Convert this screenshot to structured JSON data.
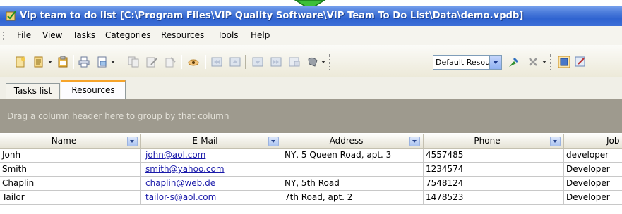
{
  "window": {
    "title": "Vip team to do list [C:\\Program Files\\VIP Quality Software\\VIP Team To Do List\\Data\\demo.vpdb]"
  },
  "menu": [
    "File",
    "View",
    "Tasks",
    "Categories",
    "Resources",
    "Tools",
    "Help"
  ],
  "toolbar": {
    "resource_combo_value": "Default Resou",
    "icons": [
      "new-task-icon",
      "new-item-icon",
      "clipboard-icon",
      "print-icon",
      "print-preview-icon",
      "copy-icon",
      "edit-icon",
      "delete-icon",
      "find-icon",
      "first-icon",
      "previous-icon",
      "next-icon",
      "last-icon",
      "filter-icon",
      "add-resource-icon",
      "remove-resource-icon",
      "view-icon",
      "settings-icon"
    ]
  },
  "tabs": [
    "Tasks list",
    "Resources"
  ],
  "active_tab": "Resources",
  "group_panel_text": "Drag a column header here to group by that column",
  "columns": [
    "Name",
    "E-Mail",
    "Address",
    "Phone",
    "Job"
  ],
  "rows": [
    {
      "name": "Jonh",
      "email": "john@aol.com",
      "address": "NY, 5 Queen Road, apt. 3",
      "phone": "4557485",
      "job": "developer"
    },
    {
      "name": "Smith",
      "email": "smith@yahoo.com",
      "address": "",
      "phone": "1234574",
      "job": "Developer"
    },
    {
      "name": "Chaplin",
      "email": "chaplin@web.de",
      "address": "NY, 5th Road",
      "phone": "7548124",
      "job": "Developer"
    },
    {
      "name": "Tailor",
      "email": "tailor-s@aol.com",
      "address": "7th Road, apt. 2",
      "phone": "1478523",
      "job": "Developer"
    }
  ],
  "colors": {
    "title_bar": "#2f63d0",
    "tab_highlight": "#f6a42a",
    "group_panel": "#9e9a8e",
    "link": "#1a1aaa"
  }
}
